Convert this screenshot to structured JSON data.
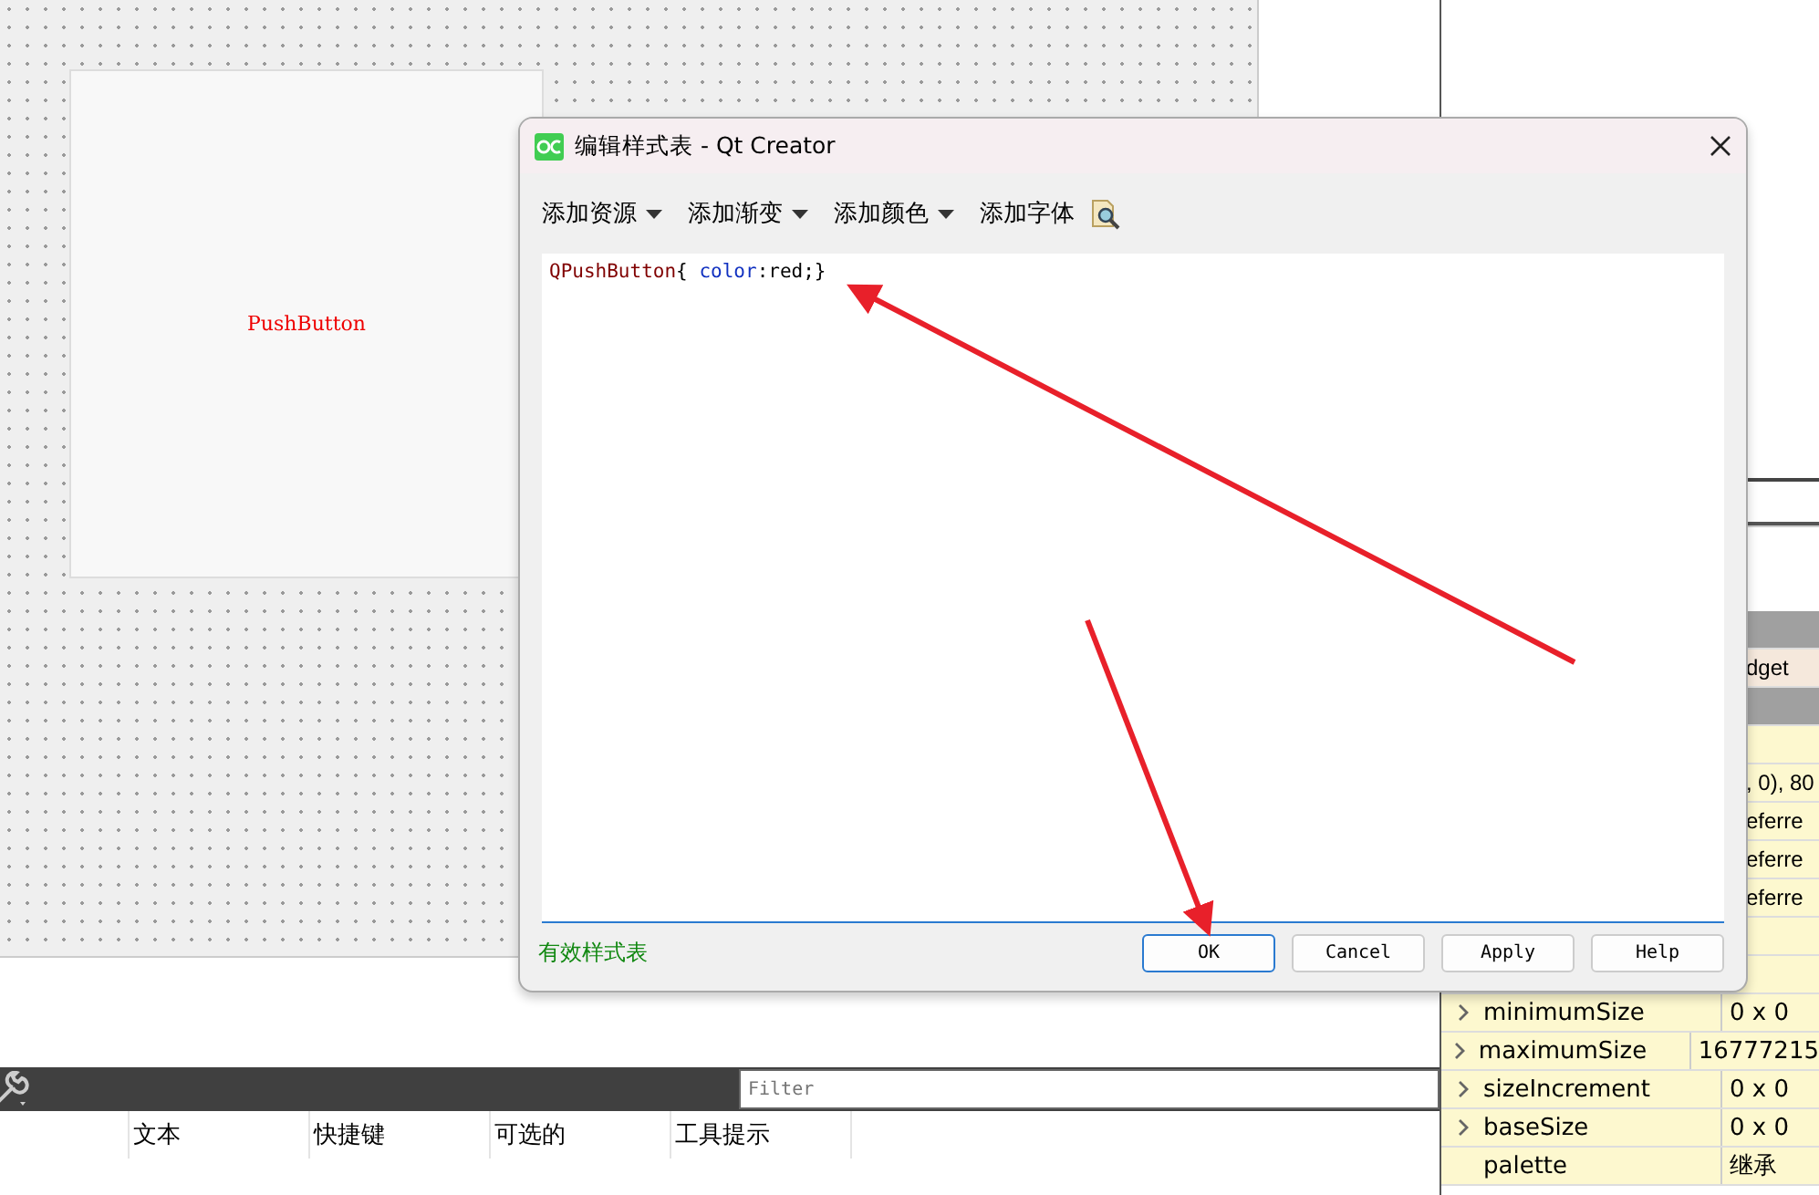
{
  "canvas": {
    "button_label": "PushButton"
  },
  "bottom_panel": {
    "filter": {
      "placeholder": "Filter"
    },
    "columns": [
      "文本",
      "快捷键",
      "可选的",
      "工具提示"
    ]
  },
  "property_panel": {
    "cut_rows": [
      {
        "kind": "header",
        "value": "",
        "selected": false
      },
      {
        "kind": "plain",
        "value": "dget",
        "selected": true
      },
      {
        "kind": "header",
        "value": "",
        "selected": false
      },
      {
        "kind": "plain",
        "value": "",
        "selected": false
      },
      {
        "kind": "plain",
        "value": ", 0), 80",
        "selected": false
      },
      {
        "kind": "plain",
        "value": "eferre",
        "selected": false
      },
      {
        "kind": "plain",
        "value": "eferre",
        "selected": false
      },
      {
        "kind": "plain",
        "value": "eferre",
        "selected": false
      },
      {
        "kind": "plain",
        "value": "",
        "selected": false
      },
      {
        "kind": "plain",
        "value": "",
        "selected": false
      }
    ],
    "rows": [
      {
        "name": "minimumSize",
        "value": "0 x 0",
        "expandable": true
      },
      {
        "name": "maximumSize",
        "value": "16777215",
        "expandable": true
      },
      {
        "name": "sizeIncrement",
        "value": "0 x 0",
        "expandable": true
      },
      {
        "name": "baseSize",
        "value": "0 x 0",
        "expandable": true
      },
      {
        "name": "palette",
        "value": "继承",
        "expandable": false
      }
    ]
  },
  "dialog": {
    "title": "编辑样式表 - Qt Creator",
    "toolbar": [
      {
        "label": "添加资源",
        "dropdown": true
      },
      {
        "label": "添加渐变",
        "dropdown": true
      },
      {
        "label": "添加颜色",
        "dropdown": true
      },
      {
        "label": "添加字体",
        "dropdown": false
      }
    ],
    "code": {
      "selector": "QPushButton",
      "open": "{ ",
      "property": "color",
      "rest": ":red;}"
    },
    "status": "有效样式表",
    "buttons": [
      {
        "label": "OK",
        "default": true
      },
      {
        "label": "Cancel",
        "default": false
      },
      {
        "label": "Apply",
        "default": false
      },
      {
        "label": "Help",
        "default": false
      }
    ]
  }
}
